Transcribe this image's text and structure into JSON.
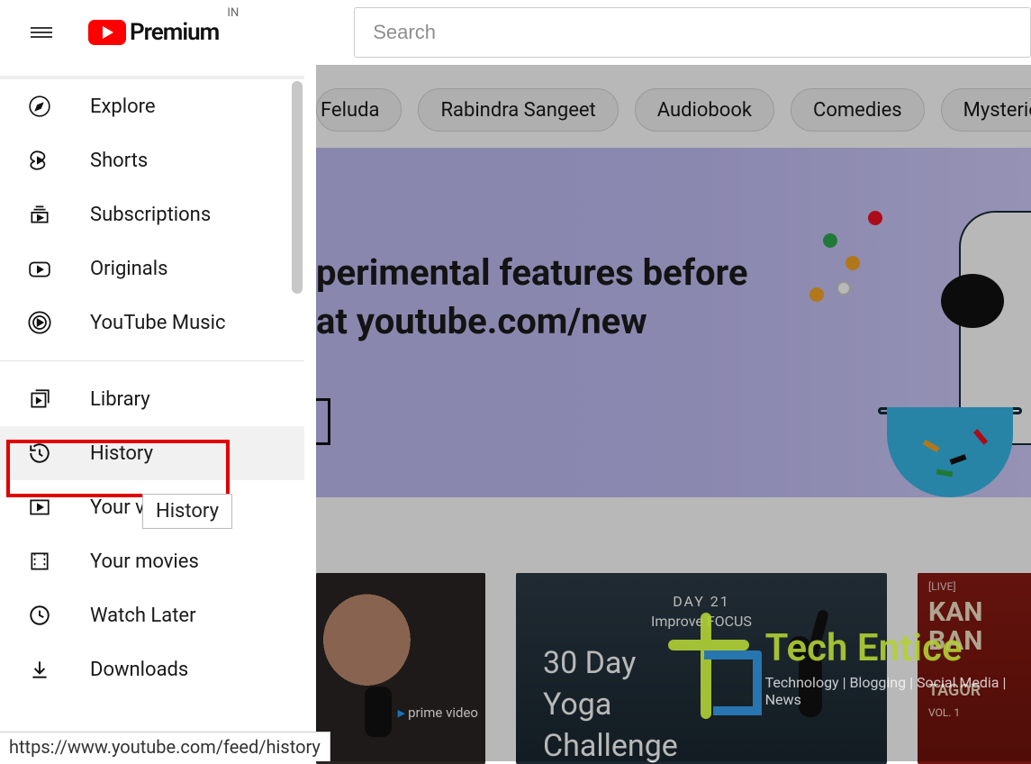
{
  "header": {
    "logo_text": "Premium",
    "country_code": "IN",
    "search_placeholder": "Search"
  },
  "chips": [
    "Feluda",
    "Rabindra Sangeet",
    "Audiobook",
    "Comedies",
    "Mysteries"
  ],
  "hero": {
    "line1": "perimental features before",
    "line2": "at youtube.com/new"
  },
  "sidebar": {
    "section1": [
      {
        "id": "explore",
        "label": "Explore"
      },
      {
        "id": "shorts",
        "label": "Shorts"
      },
      {
        "id": "subscriptions",
        "label": "Subscriptions"
      },
      {
        "id": "originals",
        "label": "Originals"
      },
      {
        "id": "ytmusic",
        "label": "YouTube Music"
      }
    ],
    "section2": [
      {
        "id": "library",
        "label": "Library"
      },
      {
        "id": "history",
        "label": "History"
      },
      {
        "id": "yourvideos",
        "label": "Your v"
      },
      {
        "id": "yourmovies",
        "label": "Your movies"
      },
      {
        "id": "watchlater",
        "label": "Watch Later"
      },
      {
        "id": "downloads",
        "label": "Downloads"
      }
    ]
  },
  "tooltip": "History",
  "status_url": "https://www.youtube.com/feed/history",
  "thumbs": {
    "t1": {
      "prime": "prime video",
      "dur": ""
    },
    "t2": {
      "day": "DAY 21",
      "sub": "Improve FOCUS",
      "big1": "30  Day",
      "big2": "Yoga",
      "big3": "Challenge"
    },
    "t3": {
      "live": "[LIVE]",
      "title1": "KAN",
      "title2": "BAN",
      "sub": "TAGOR",
      "vol": "VOL. 1"
    }
  },
  "watermark": {
    "name": "Tech Entice",
    "tag": "Technology | Blogging | Social Media | News"
  }
}
